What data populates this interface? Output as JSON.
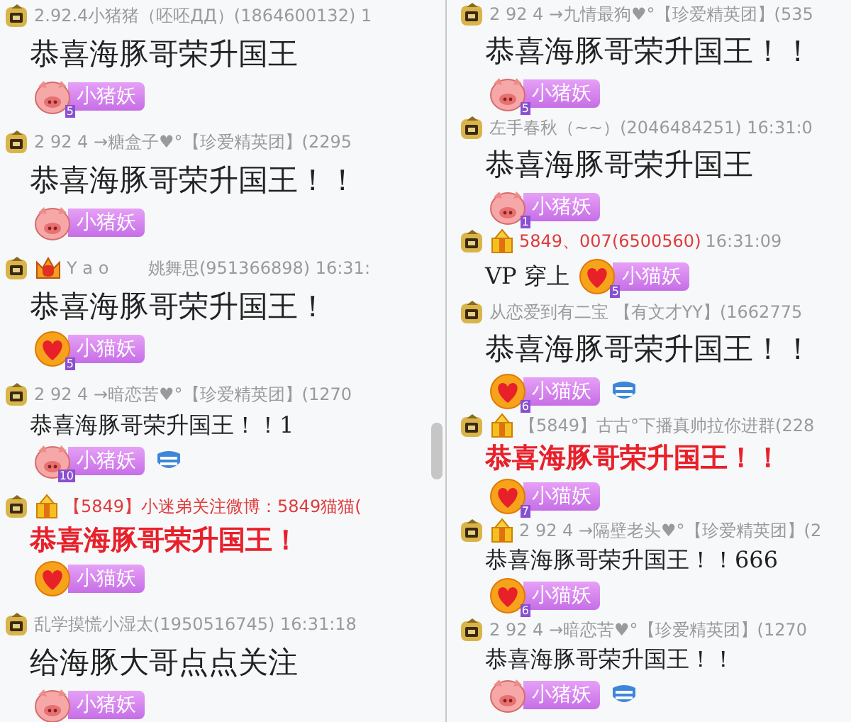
{
  "panes": [
    {
      "messages": [
        {
          "header": {
            "icons": [
              {
                "kind": "rank"
              }
            ],
            "parts": [
              {
                "text": "2.92.4小猪猪（呸呸ДД）(1864600132) 1",
                "red": false
              }
            ]
          },
          "message": {
            "kind": "large",
            "text": "恭喜海豚哥荣升国王"
          },
          "badge": {
            "kind": "pig",
            "label": "小猪妖",
            "rank": "5",
            "inline": false
          },
          "emblem": false
        },
        {
          "header": {
            "icons": [
              {
                "kind": "rank"
              }
            ],
            "parts": [
              {
                "text": "2 92 4 →糖盒子♥°【珍爱精英团】(2295",
                "red": false
              }
            ]
          },
          "message": {
            "kind": "large",
            "text": "恭喜海豚哥荣升国王！！"
          },
          "badge": {
            "kind": "pig",
            "label": "小猪妖",
            "inline": false
          },
          "emblem": false
        },
        {
          "header": {
            "icons": [
              {
                "kind": "rank"
              },
              {
                "kind": "crown"
              }
            ],
            "parts": [
              {
                "text": "Y a o 　　姚舞思(951366898) 16:31:",
                "red": false
              }
            ]
          },
          "message": {
            "kind": "large",
            "text": "恭喜海豚哥荣升国王！"
          },
          "badge": {
            "kind": "heart",
            "label": "小猫妖",
            "rank": "5",
            "inline": false
          },
          "emblem": false
        },
        {
          "header": {
            "icons": [
              {
                "kind": "rank"
              }
            ],
            "parts": [
              {
                "text": "2 92 4 →暗恋苦♥°【珍爱精英团】(1270",
                "red": false
              }
            ]
          },
          "message": {
            "kind": "plain",
            "text": "恭喜海豚哥荣升国王！！1"
          },
          "badge": {
            "kind": "pig",
            "label": "小猪妖",
            "rank": "10",
            "inline": false
          },
          "emblem": true
        },
        {
          "header": {
            "icons": [
              {
                "kind": "rank"
              },
              {
                "kind": "gift"
              }
            ],
            "parts": [
              {
                "text": "【5849】小迷弟关注微博：5849猫猫(",
                "red": true
              }
            ]
          },
          "message": {
            "kind": "red",
            "text": "恭喜海豚哥荣升国王！"
          },
          "badge": {
            "kind": "heart",
            "label": "小猫妖",
            "inline": false
          },
          "emblem": false
        },
        {
          "header": {
            "icons": [
              {
                "kind": "rank"
              }
            ],
            "parts": [
              {
                "text": "乱学摸慌小湿太(1950516745) 16:31:18",
                "red": false
              }
            ]
          },
          "message": {
            "kind": "large",
            "text": "给海豚大哥点点关注"
          },
          "badge": {
            "kind": "pig",
            "label": "小猪妖",
            "inline": false
          },
          "emblem": false
        }
      ],
      "scrollbar": true
    },
    {
      "messages": [
        {
          "header": {
            "icons": [
              {
                "kind": "rank"
              }
            ],
            "parts": [
              {
                "text": "2 92 4 →九情最狗♥°【珍爱精英团】(535",
                "red": false
              }
            ]
          },
          "message": {
            "kind": "large",
            "text": "恭喜海豚哥荣升国王！！"
          },
          "badge": {
            "kind": "pig",
            "label": "小猪妖",
            "rank": "5",
            "inline": false
          },
          "emblem": false
        },
        {
          "header": {
            "icons": [
              {
                "kind": "rank"
              }
            ],
            "parts": [
              {
                "text": "左手春秋（~~）(2046484251) 16:31:0",
                "red": false
              }
            ]
          },
          "message": {
            "kind": "large",
            "text": "恭喜海豚哥荣升国王"
          },
          "badge": {
            "kind": "pig",
            "label": "小猪妖",
            "rank": "1",
            "inline": false
          },
          "emblem": false
        },
        {
          "header": {
            "icons": [
              {
                "kind": "rank"
              },
              {
                "kind": "gift"
              }
            ],
            "parts": [
              {
                "text": "5849、007(6500560)",
                "red": true
              },
              {
                "text": "16:31:09",
                "red": false
              }
            ]
          },
          "message": {
            "kind": "plain",
            "text": "VP 穿上"
          },
          "badge": {
            "kind": "heart",
            "label": "小猫妖",
            "rank": "5",
            "inline": true
          },
          "emblem": false
        },
        {
          "header": {
            "icons": [
              {
                "kind": "rank"
              }
            ],
            "parts": [
              {
                "text": "从恋爱到有二宝 【有文才YY】(1662775",
                "red": false
              }
            ]
          },
          "message": {
            "kind": "large",
            "text": "恭喜海豚哥荣升国王！！"
          },
          "badge": {
            "kind": "heart",
            "label": "小猫妖",
            "rank": "6",
            "inline": false
          },
          "emblem": true
        },
        {
          "header": {
            "icons": [
              {
                "kind": "rank"
              },
              {
                "kind": "gift"
              }
            ],
            "parts": [
              {
                "text": "【5849】古古°下播真帅拉你进群(228",
                "red": false
              }
            ]
          },
          "message": {
            "kind": "red",
            "text": "恭喜海豚哥荣升国王！！"
          },
          "badge": {
            "kind": "heart",
            "label": "小猫妖",
            "rank": "7",
            "inline": false
          },
          "emblem": false
        },
        {
          "header": {
            "icons": [
              {
                "kind": "rank"
              },
              {
                "kind": "gift"
              }
            ],
            "parts": [
              {
                "text": "2 92 4 →隔壁老头♥°【珍爱精英团】(2",
                "red": false
              }
            ]
          },
          "message": {
            "kind": "plain",
            "text": "恭喜海豚哥荣升国王！！666"
          },
          "badge": {
            "kind": "heart",
            "label": "小猫妖",
            "rank": "6",
            "inline": false
          },
          "emblem": false
        },
        {
          "header": {
            "icons": [
              {
                "kind": "rank"
              }
            ],
            "parts": [
              {
                "text": "2 92 4 →暗恋苦♥°【珍爱精英团】(1270",
                "red": false
              }
            ]
          },
          "message": {
            "kind": "plain",
            "text": "恭喜海豚哥荣升国王！！"
          },
          "badge": {
            "kind": "pig",
            "label": "小猪妖",
            "inline": false
          },
          "emblem": true
        }
      ],
      "scrollbar": false
    }
  ]
}
